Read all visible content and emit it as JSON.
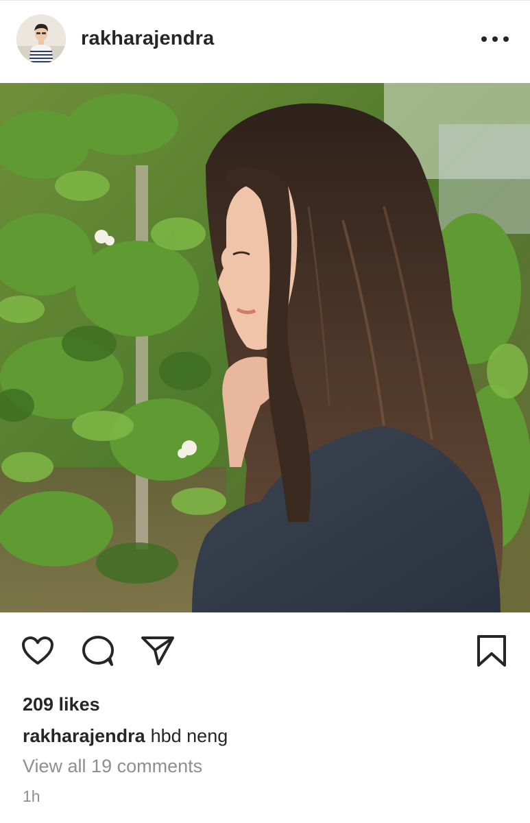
{
  "post": {
    "username": "rakharajendra",
    "likes_text": "209 likes",
    "caption_user": "rakharajendra",
    "caption_text": "hbd neng",
    "view_comments": "View all 19 comments",
    "time": "1h"
  },
  "icons": {
    "more": "more-horizontal-icon",
    "like": "heart-outline-icon",
    "comment": "comment-bubble-icon",
    "share": "paper-plane-icon",
    "save": "bookmark-outline-icon"
  },
  "colors": {
    "text": "#262626",
    "secondary_text": "#8e8e8e",
    "border": "#e6e6e6"
  }
}
